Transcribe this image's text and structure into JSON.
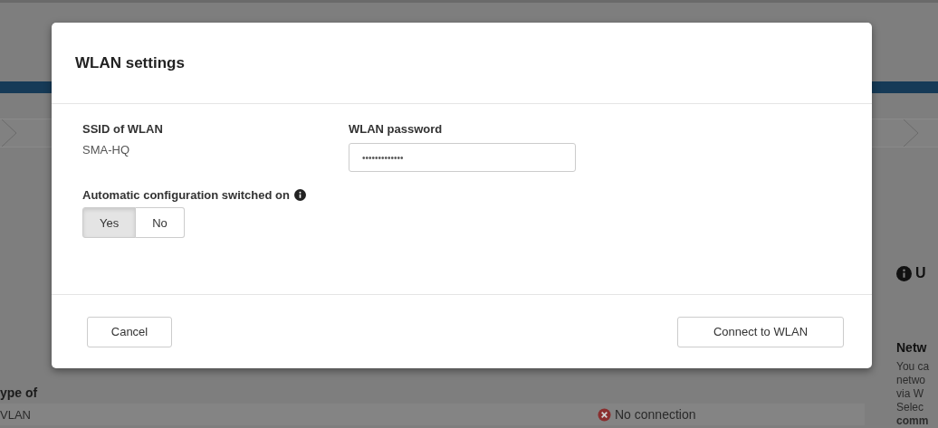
{
  "background": {
    "sidebar": {
      "info_heading": "U",
      "heading": "Netw",
      "lines": [
        "You ca",
        "netwo",
        "via W",
        "Selec",
        "comm"
      ]
    },
    "table": {
      "header": "ype of",
      "rows": [
        {
          "name": "VLAN",
          "status": "No connection",
          "kind": "error"
        }
      ]
    }
  },
  "dialog": {
    "title": "WLAN settings",
    "ssid": {
      "label": "SSID of WLAN",
      "value": "SMA-HQ"
    },
    "password": {
      "label": "WLAN password",
      "value": "•••••••••••••"
    },
    "auto_config": {
      "label": "Automatic configuration switched on",
      "options": [
        {
          "label": "Yes",
          "selected": true
        },
        {
          "label": "No",
          "selected": false
        }
      ]
    },
    "buttons": [
      {
        "label": "Cancel",
        "kind": "cancel"
      },
      {
        "label": "Connect to WLAN",
        "kind": "confirm"
      }
    ]
  }
}
